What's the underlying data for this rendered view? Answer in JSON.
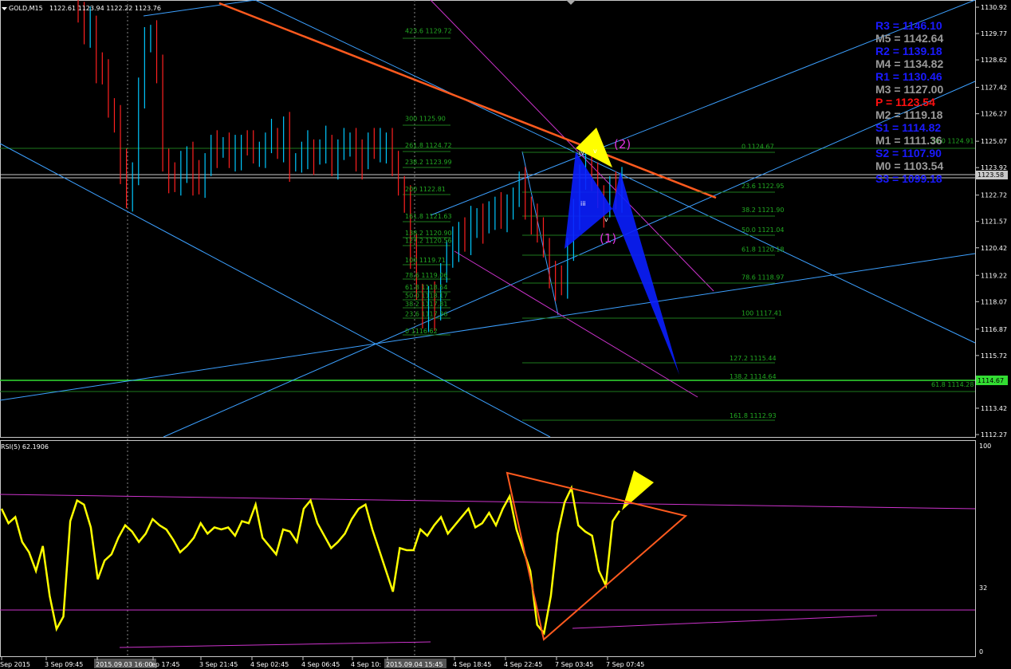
{
  "header": {
    "symbol": "GOLD,M15",
    "ohlc": "1122.61 1123.94 1122.22 1123.76"
  },
  "rsi_header": "RSI(5) 62.1906",
  "colors": {
    "bull_candle": "#00c8ff",
    "bear_candle": "#ff2020",
    "rsi_line": "#ffff00",
    "fib": "#22aa22",
    "trendline": "#ff5a1e",
    "channel": "#3ca0ff",
    "magenta": "#cc33cc",
    "pattern_fill": "#0a1eff",
    "marker": "#ffff00",
    "pivot_resistance": "#1a1aff",
    "pivot_mid": "#9a9a9a",
    "pivot_p": "#ff1010"
  },
  "price_axis": {
    "labels": [
      "1130.92",
      "1129.77",
      "1128.62",
      "1127.42",
      "1126.27",
      "1125.07",
      "1123.92",
      "1122.72",
      "1121.57",
      "1120.42",
      "1119.22",
      "1118.07",
      "1116.87",
      "1115.72",
      "1114.57",
      "1113.42",
      "1112.27"
    ],
    "current_price": "1123.58",
    "marked_price": "1114.67"
  },
  "rsi_axis": {
    "labels": [
      "100",
      "32",
      "0"
    ]
  },
  "time_axis": {
    "labels": [
      "Sep 2015",
      "3 Sep 09:45",
      "2015.09.03 16:00",
      "ep 17:45",
      "3 Sep 21:45",
      "4 Sep 02:45",
      "4 Sep 06:45",
      "4 Sep 10:",
      "2015.09.04 15:45",
      "4 Sep 18:45",
      "4 Sep 22:45",
      "7 Sep 03:45",
      "7 Sep 07:45"
    ]
  },
  "pivots": [
    {
      "label": "R3 = 1146.10",
      "kind": "r"
    },
    {
      "label": "M5 = 1142.64",
      "kind": "m"
    },
    {
      "label": "R2 = 1139.18",
      "kind": "r"
    },
    {
      "label": "M4 = 1134.82",
      "kind": "m"
    },
    {
      "label": "R1 = 1130.46",
      "kind": "r"
    },
    {
      "label": "M3 = 1127.00",
      "kind": "m"
    },
    {
      "label": "P  = 1123.54",
      "kind": "p"
    },
    {
      "label": "M2 = 1119.18",
      "kind": "m"
    },
    {
      "label": "S1 = 1114.82",
      "kind": "r"
    },
    {
      "label": "M1 = 1111.36",
      "kind": "m"
    },
    {
      "label": "S2 = 1107.90",
      "kind": "r"
    },
    {
      "label": "M0 = 1103.54",
      "kind": "m"
    },
    {
      "label": "S3 = 1099.18",
      "kind": "r"
    }
  ],
  "fib_left": [
    "423.6 1129.72",
    "300 1125.90",
    "261.8 1124.72",
    "238.2 1123.99",
    "200 1122.81",
    "161.8 1121.63",
    "138.2 1120.90",
    "127.2 1120.56",
    "100 1119.71",
    "78.6 1119.06",
    "61.8 1118.54",
    "50.0 1118.17",
    "38.2 1117.81",
    "23.6 1117.36",
    "0 1116.62"
  ],
  "fib_right": [
    "0 1124.67",
    "50.0 1124.91",
    "23.6 1122.95",
    "38.2 1121.90",
    "50.0 1121.04",
    "61.8 1120.18",
    "78.6 1118.97",
    "100 1117.41",
    "127.2 1115.44",
    "138.2 1114.64",
    "61.8 1114.28",
    "161.8 1112.93"
  ],
  "wave_labels": [
    "(2)",
    "(1)",
    "iii",
    "iv",
    "v",
    "v"
  ],
  "chart_data": {
    "type": "line",
    "title": "GOLD,M15",
    "price_range": [
      1112.27,
      1130.92
    ],
    "rsi_range": [
      0,
      100
    ],
    "current_price": 1123.58,
    "price_close": [
      1130.6,
      1129.8,
      1130.2,
      1128.4,
      1127.9,
      1126.6,
      1126.1,
      1124.0,
      1122.5,
      1123.8,
      1127.3,
      1129.3,
      1129.8,
      1128.1,
      1124.4,
      1123.6,
      1123.2,
      1123.9,
      1124.5,
      1123.5,
      1123.1,
      1124.2,
      1124.8,
      1124.7,
      1124.9,
      1124.4,
      1124.6,
      1125.0,
      1124.8,
      1124.6,
      1124.7,
      1124.9,
      1125.3,
      1124.8,
      1125.6,
      1124.1,
      1124.2,
      1124.5,
      1124.8,
      1124.4,
      1124.6,
      1125.0,
      1124.2,
      1124.6,
      1124.9,
      1125.1,
      1124.4,
      1124.2,
      1125.1,
      1124.8,
      1124.9,
      1125.1,
      1123.9,
      1123.2,
      1122.6,
      1120.3,
      1118.5,
      1117.4,
      1118.2,
      1117.6,
      1119.4,
      1120.2,
      1120.6,
      1121.2,
      1120.6,
      1121.5,
      1121.8,
      1121.4,
      1121.7,
      1122.3,
      1121.9,
      1122.0,
      1122.7,
      1123.2,
      1122.3,
      1121.8,
      1121.0,
      1120.5,
      1119.3,
      1118.9,
      1118.7,
      1120.5,
      1122.0,
      1123.3,
      1124.5,
      1123.4,
      1122.8,
      1122.1,
      1123.0,
      1122.6,
      1123.6
    ],
    "rsi": [
      70,
      63,
      66,
      54,
      49,
      40,
      52,
      28,
      12,
      18,
      64,
      74,
      72,
      61,
      36,
      45,
      48,
      56,
      62,
      59,
      54,
      58,
      65,
      62,
      60,
      55,
      49,
      52,
      56,
      63,
      58,
      61,
      60,
      61,
      57,
      64,
      63,
      72,
      56,
      52,
      48,
      60,
      59,
      54,
      70,
      74,
      63,
      57,
      51,
      54,
      58,
      65,
      70,
      72,
      60,
      50,
      40,
      30,
      51,
      50,
      50,
      60,
      57,
      62,
      66,
      58,
      62,
      66,
      70,
      61,
      63,
      68,
      62,
      70,
      76,
      60,
      50,
      40,
      14,
      10,
      28,
      58,
      73,
      80,
      62,
      59,
      57,
      40,
      33,
      64,
      69
    ],
    "annotations": [
      "(1)",
      "(2)",
      "iii",
      "iv",
      "v"
    ]
  }
}
